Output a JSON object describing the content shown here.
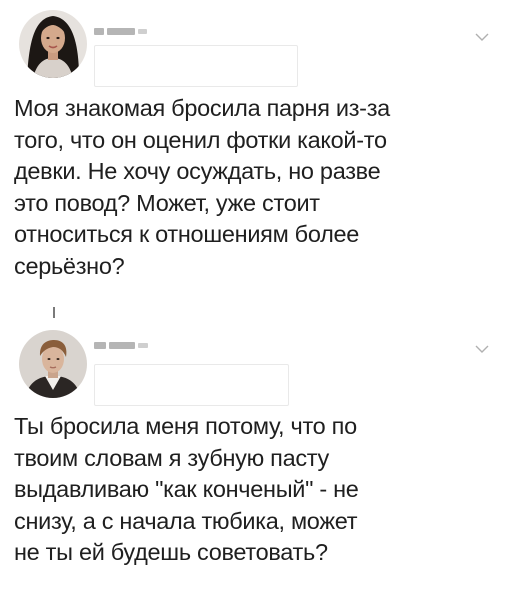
{
  "tweets": [
    {
      "lines": [
        "Моя знакомая бросила парня из-за",
        "того, что он оценил фотки какой-то",
        "девки. Не хочу осуждать, но разве",
        "это повод? Может, уже стоит",
        "относиться к отношениям более",
        "серьёзно?"
      ]
    },
    {
      "lines": [
        "Ты бросила меня потому, что по",
        "твоим словам я зубную пасту",
        "выдавливаю \"как конченый\" - не",
        "снизу, а с начала тюбика, может",
        "не ты ей будешь советовать?"
      ]
    }
  ],
  "icons": {
    "menu": "chevron-down-icon"
  },
  "colors": {
    "text": "#1f1f1f",
    "chevron": "#b0b0b0",
    "redaction": "#b5b5b5"
  }
}
